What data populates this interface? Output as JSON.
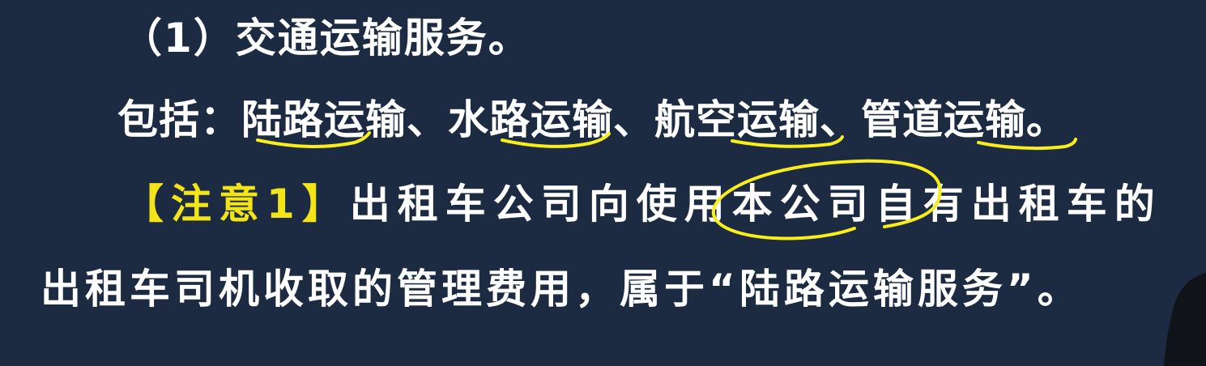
{
  "slide": {
    "heading": "（1）交通运输服务。",
    "includes_label": "包括：",
    "transport_items": [
      "陆路运输",
      "水路运输",
      "航空运输",
      "管道运输"
    ],
    "separator": "、",
    "ending_period": "。",
    "note_label": "【注意1】",
    "note_part1": "出租车公司向使用本公司自有出租车的",
    "note_part2": "出租车司机收取的管理费用，属于“陆路运输服务”。"
  },
  "colors": {
    "background": "#1c2a42",
    "text": "#ffffff",
    "note_label": "#f2e418",
    "annotation_stroke": "#f7ee1c"
  }
}
